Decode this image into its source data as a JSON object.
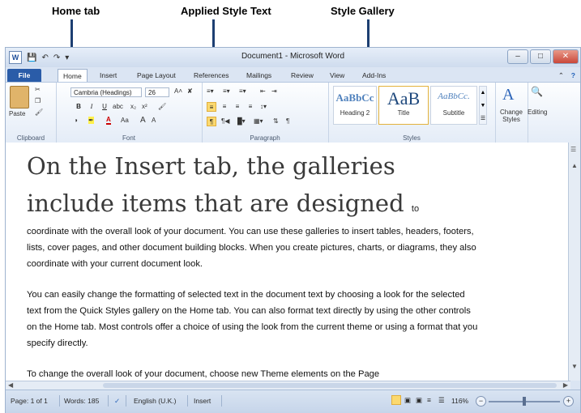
{
  "callouts": {
    "home_tab": "Home tab",
    "applied_style": "Applied Style Text",
    "style_gallery": "Style Gallery"
  },
  "window": {
    "title": "Document1 - Microsoft Word",
    "file_tab": "File",
    "tabs": [
      "Home",
      "Insert",
      "Page Layout",
      "References",
      "Mailings",
      "Review",
      "View",
      "Add-Ins"
    ]
  },
  "ribbon": {
    "clipboard": {
      "paste": "Paste",
      "label": "Clipboard"
    },
    "font": {
      "name": "Cambria (Headings)",
      "size": "26",
      "label": "Font",
      "bold": "B",
      "italic": "I",
      "underline": "U",
      "grow": "A",
      "shrink": "A"
    },
    "paragraph": {
      "label": "Paragraph"
    },
    "styles": {
      "label": "Styles",
      "items": [
        {
          "sample": "AaBbCc",
          "name": "Heading 2"
        },
        {
          "sample": "AaB",
          "name": "Title"
        },
        {
          "sample": "AaBbCc.",
          "name": "Subtitle"
        }
      ],
      "change_styles": "Change Styles",
      "editing": "Editing"
    }
  },
  "document": {
    "heading_line1": "On the Insert tab, the galleries",
    "heading_line2": "include items that are designed",
    "heading_tail": "to",
    "paragraph1": "coordinate with the overall look of your document. You can use these galleries to insert tables, headers, footers, lists, cover pages, and other document building blocks. When you create pictures, charts, or diagrams, they also coordinate with your current document look.",
    "paragraph2": "You can easily change the formatting of selected text in the document text by choosing a look for the selected text from the Quick Styles gallery on the Home tab. You can also format text directly by using the other controls on the Home tab. Most controls offer a choice of using the look from the current theme or using a format that you specify directly.",
    "paragraph3": "To change the overall look of your document, choose new Theme elements on the Page"
  },
  "status": {
    "page": "Page: 1 of 1",
    "words": "Words: 185",
    "language": "English (U.K.)",
    "mode": "Insert",
    "zoom": "116%"
  }
}
